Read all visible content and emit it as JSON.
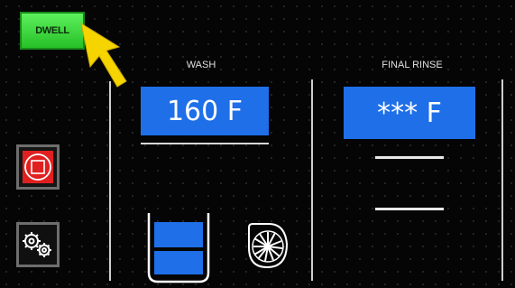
{
  "dwell_button": {
    "label": "DWELL"
  },
  "wash": {
    "title": "WASH",
    "temperature": "160 F"
  },
  "final_rinse": {
    "title": "FINAL RINSE",
    "temperature": "*** F"
  },
  "icons": {
    "pointer": "pointer-arrow-icon",
    "stop": "stop-icon",
    "settings": "gears-icon",
    "tank": "tank-icon",
    "fan": "fan-icon"
  },
  "colors": {
    "dwell_green": "#3fd83f",
    "temp_blue": "#1e6fe8",
    "stop_red": "#e02020",
    "pointer_yellow": "#f5d400",
    "background": "#050505"
  }
}
